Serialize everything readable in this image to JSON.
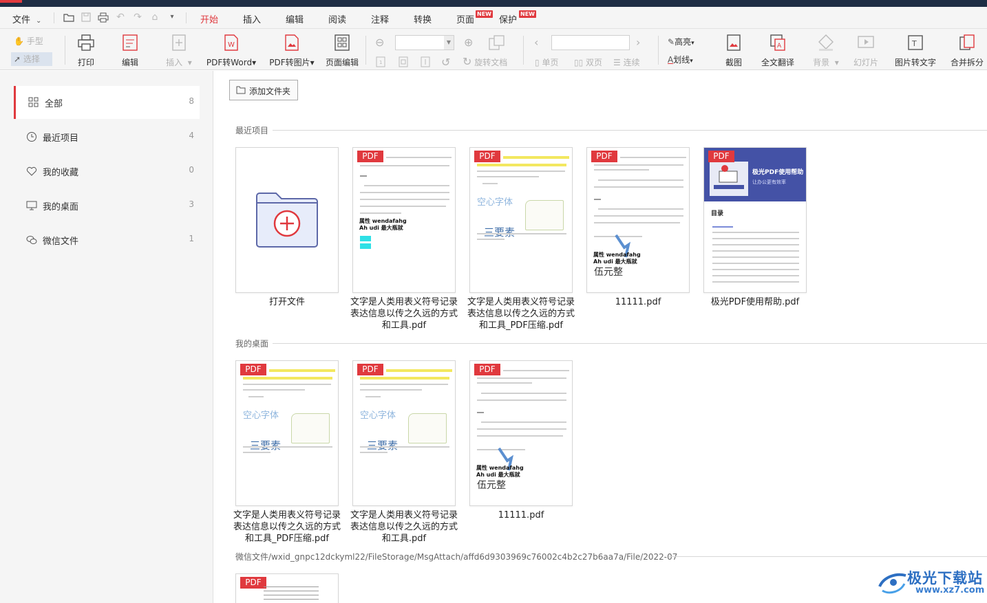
{
  "menu": {
    "file": "文件",
    "tabs": [
      {
        "label": "开始"
      },
      {
        "label": "插入"
      },
      {
        "label": "编辑"
      },
      {
        "label": "阅读"
      },
      {
        "label": "注释"
      },
      {
        "label": "转换"
      },
      {
        "label": "页面",
        "badge": "NEW"
      },
      {
        "label": "保护",
        "badge": "NEW"
      }
    ],
    "active_tab": "开始",
    "accent_color": "#e0393e"
  },
  "toolbar": {
    "hand": "手型",
    "select": "选择",
    "print": "打印",
    "edit": "编辑",
    "insert": "插入",
    "pdf_to_word": "PDF转Word",
    "pdf_to_image": "PDF转图片",
    "page_edit": "页面编辑",
    "rotate_doc": "旋转文档",
    "single_page": "单页",
    "double_page": "双页",
    "continuous": "连续",
    "highlight": "高亮",
    "strikethrough": "划线",
    "screenshot": "截图",
    "full_translate": "全文翻译",
    "background": "背景",
    "slideshow": "幻灯片",
    "image_to_text": "图片转文字",
    "merge_split": "合并拆分"
  },
  "sidebar": {
    "items": [
      {
        "label": "全部",
        "count": "8",
        "icon": "grid-icon"
      },
      {
        "label": "最近项目",
        "count": "4",
        "icon": "clock-icon"
      },
      {
        "label": "我的收藏",
        "count": "0",
        "icon": "heart-icon"
      },
      {
        "label": "我的桌面",
        "count": "3",
        "icon": "monitor-icon"
      },
      {
        "label": "微信文件",
        "count": "1",
        "icon": "wechat-icon"
      }
    ]
  },
  "main": {
    "add_folder": "添加文件夹",
    "pdf_tag": "PDF",
    "recent": {
      "title": "最近项目",
      "open_file": "打开文件",
      "files": [
        "文字是人类用表义符号记录表达信息以传之久远的方式和工具.pdf",
        "文字是人类用表义符号记录表达信息以传之久远的方式和工具_PDF压缩.pdf",
        "11111.pdf",
        "极光PDF使用帮助.pdf"
      ]
    },
    "desktop": {
      "title": "我的桌面",
      "files": [
        "文字是人类用表义符号记录表达信息以传之久远的方式和工具_PDF压缩.pdf",
        "文字是人类用表义符号记录表达信息以传之久远的方式和工具.pdf",
        "11111.pdf"
      ]
    },
    "wechat": {
      "title": "微信文件/wxid_gnpc12dckyml22/FileStorage/MsgAttach/affd6d9303969c76002c4b2c27b6aa7a/File/2022-07"
    },
    "thumb_text": {
      "prop": "属性 wendafahg",
      "ahudi": "Ah udi 最大瓶就",
      "hollow": "空心字体",
      "three": "三要素",
      "wuyuan": "伍元整",
      "help_title": "极光PDF使用帮助",
      "help_sub": "让办公更有效率",
      "toc": "目录"
    }
  },
  "watermark": {
    "name": "极光下载站",
    "url": "www.xz7.com"
  }
}
